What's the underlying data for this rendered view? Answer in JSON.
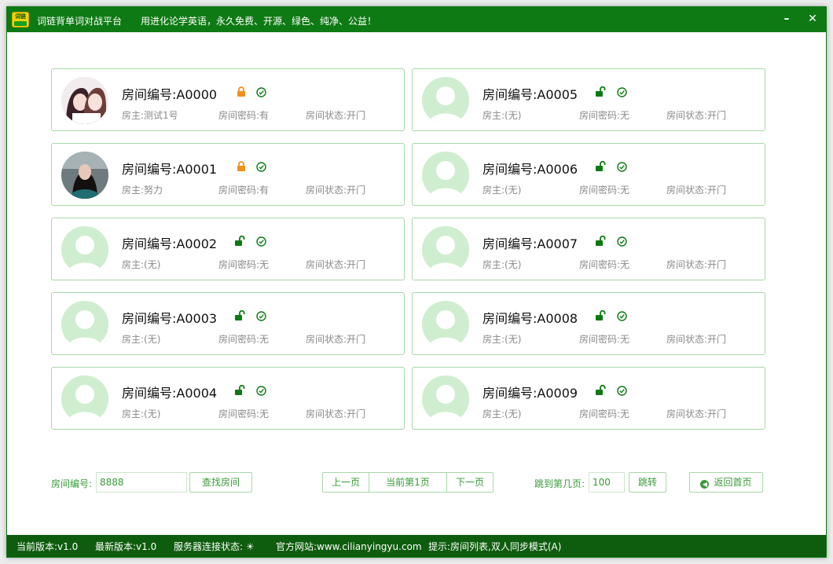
{
  "window": {
    "app_name": "词链背单词对战平台",
    "slogan": "用进化论学英语，永久免费、开源、绿色、纯净、公益！",
    "logo_text": "词链",
    "min_glyph": "–",
    "close_glyph": "✕"
  },
  "rooms": [
    {
      "title": "房间编号:A0000",
      "host": "房主:测试1号",
      "password": "房间密码:有",
      "status": "房间状态:开门",
      "lock": "locked",
      "avatar": "anime-girls"
    },
    {
      "title": "房间编号:A0005",
      "host": "房主:(无)",
      "password": "房间密码:无",
      "status": "房间状态:开门",
      "lock": "unlocked",
      "avatar": "placeholder"
    },
    {
      "title": "房间编号:A0001",
      "host": "房主:努力",
      "password": "房间密码:有",
      "status": "房间状态:开门",
      "lock": "locked",
      "avatar": "photo-woman"
    },
    {
      "title": "房间编号:A0006",
      "host": "房主:(无)",
      "password": "房间密码:无",
      "status": "房间状态:开门",
      "lock": "unlocked",
      "avatar": "placeholder"
    },
    {
      "title": "房间编号:A0002",
      "host": "房主:(无)",
      "password": "房间密码:无",
      "status": "房间状态:开门",
      "lock": "unlocked",
      "avatar": "placeholder"
    },
    {
      "title": "房间编号:A0007",
      "host": "房主:(无)",
      "password": "房间密码:无",
      "status": "房间状态:开门",
      "lock": "unlocked",
      "avatar": "placeholder"
    },
    {
      "title": "房间编号:A0003",
      "host": "房主:(无)",
      "password": "房间密码:无",
      "status": "房间状态:开门",
      "lock": "unlocked",
      "avatar": "placeholder"
    },
    {
      "title": "房间编号:A0008",
      "host": "房主:(无)",
      "password": "房间密码:无",
      "status": "房间状态:开门",
      "lock": "unlocked",
      "avatar": "placeholder"
    },
    {
      "title": "房间编号:A0004",
      "host": "房主:(无)",
      "password": "房间密码:无",
      "status": "房间状态:开门",
      "lock": "unlocked",
      "avatar": "placeholder"
    },
    {
      "title": "房间编号:A0009",
      "host": "房主:(无)",
      "password": "房间密码:无",
      "status": "房间状态:开门",
      "lock": "unlocked",
      "avatar": "placeholder"
    }
  ],
  "search": {
    "label": "房间编号:",
    "value": "8888",
    "button": "查找房间"
  },
  "pager": {
    "prev": "上一页",
    "current": "当前第1页",
    "next": "下一页",
    "jump_label": "跳到第几页:",
    "jump_value": "100",
    "jump_button": "跳转"
  },
  "home_button": "返回首页",
  "statusbar": {
    "current_version": "当前版本:v1.0",
    "latest_version": "最新版本:v1.0",
    "server_status": "服务器连接状态: ☀",
    "website": "官方网站:www.cilianyingyu.com",
    "hint": "提示:房间列表,双人同步模式(A)"
  },
  "colors": {
    "brand_green": "#0e7a14",
    "statusbar_green": "#0e5d0e",
    "card_border": "#a9d8a9",
    "locked_orange": "#f0901e",
    "unlocked_green": "#0e7a14",
    "avatar_placeholder": "#cfeed0"
  }
}
